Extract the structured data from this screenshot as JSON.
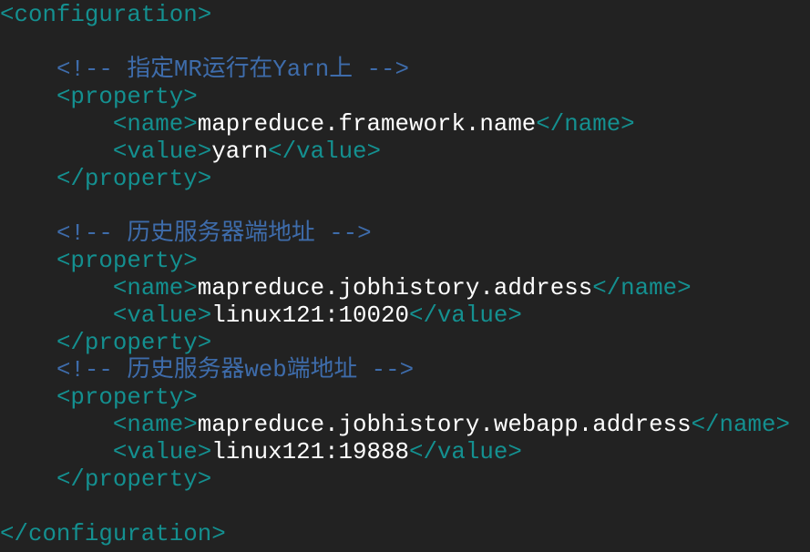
{
  "colors": {
    "background": "#222222",
    "tag": "#149090",
    "comment": "#3e6cab",
    "text": "#ffffff"
  },
  "lines": [
    {
      "indent": 0,
      "parts": [
        {
          "t": "tag",
          "v": "<configuration>"
        }
      ]
    },
    {
      "indent": 0,
      "parts": []
    },
    {
      "indent": 1,
      "parts": [
        {
          "t": "comment",
          "v": "<!-- 指定MR运行在Yarn上 -->"
        }
      ]
    },
    {
      "indent": 1,
      "parts": [
        {
          "t": "tag",
          "v": "<property>"
        }
      ]
    },
    {
      "indent": 2,
      "parts": [
        {
          "t": "tag",
          "v": "<name>"
        },
        {
          "t": "text",
          "v": "mapreduce.framework.name"
        },
        {
          "t": "tag",
          "v": "</name>"
        }
      ]
    },
    {
      "indent": 2,
      "parts": [
        {
          "t": "tag",
          "v": "<value>"
        },
        {
          "t": "text",
          "v": "yarn"
        },
        {
          "t": "tag",
          "v": "</value>"
        }
      ]
    },
    {
      "indent": 1,
      "parts": [
        {
          "t": "tag",
          "v": "</property>"
        }
      ]
    },
    {
      "indent": 0,
      "parts": []
    },
    {
      "indent": 1,
      "parts": [
        {
          "t": "comment",
          "v": "<!-- 历史服务器端地址 -->"
        }
      ]
    },
    {
      "indent": 1,
      "parts": [
        {
          "t": "tag",
          "v": "<property>"
        }
      ]
    },
    {
      "indent": 2,
      "parts": [
        {
          "t": "tag",
          "v": "<name>"
        },
        {
          "t": "text",
          "v": "mapreduce.jobhistory.address"
        },
        {
          "t": "tag",
          "v": "</name>"
        }
      ]
    },
    {
      "indent": 2,
      "parts": [
        {
          "t": "tag",
          "v": "<value>"
        },
        {
          "t": "text",
          "v": "linux121:10020"
        },
        {
          "t": "tag",
          "v": "</value>"
        }
      ]
    },
    {
      "indent": 1,
      "parts": [
        {
          "t": "tag",
          "v": "</property>"
        }
      ]
    },
    {
      "indent": 1,
      "parts": [
        {
          "t": "comment",
          "v": "<!-- 历史服务器web端地址 -->"
        }
      ]
    },
    {
      "indent": 1,
      "parts": [
        {
          "t": "tag",
          "v": "<property>"
        }
      ]
    },
    {
      "indent": 2,
      "parts": [
        {
          "t": "tag",
          "v": "<name>"
        },
        {
          "t": "text",
          "v": "mapreduce.jobhistory.webapp.address"
        },
        {
          "t": "tag",
          "v": "</name>"
        }
      ]
    },
    {
      "indent": 2,
      "parts": [
        {
          "t": "tag",
          "v": "<value>"
        },
        {
          "t": "text",
          "v": "linux121:19888"
        },
        {
          "t": "tag",
          "v": "</value>"
        }
      ]
    },
    {
      "indent": 1,
      "parts": [
        {
          "t": "tag",
          "v": "</property>"
        }
      ]
    },
    {
      "indent": 0,
      "parts": []
    },
    {
      "indent": 0,
      "parts": [
        {
          "t": "tag",
          "v": "</configuration>"
        }
      ]
    }
  ]
}
